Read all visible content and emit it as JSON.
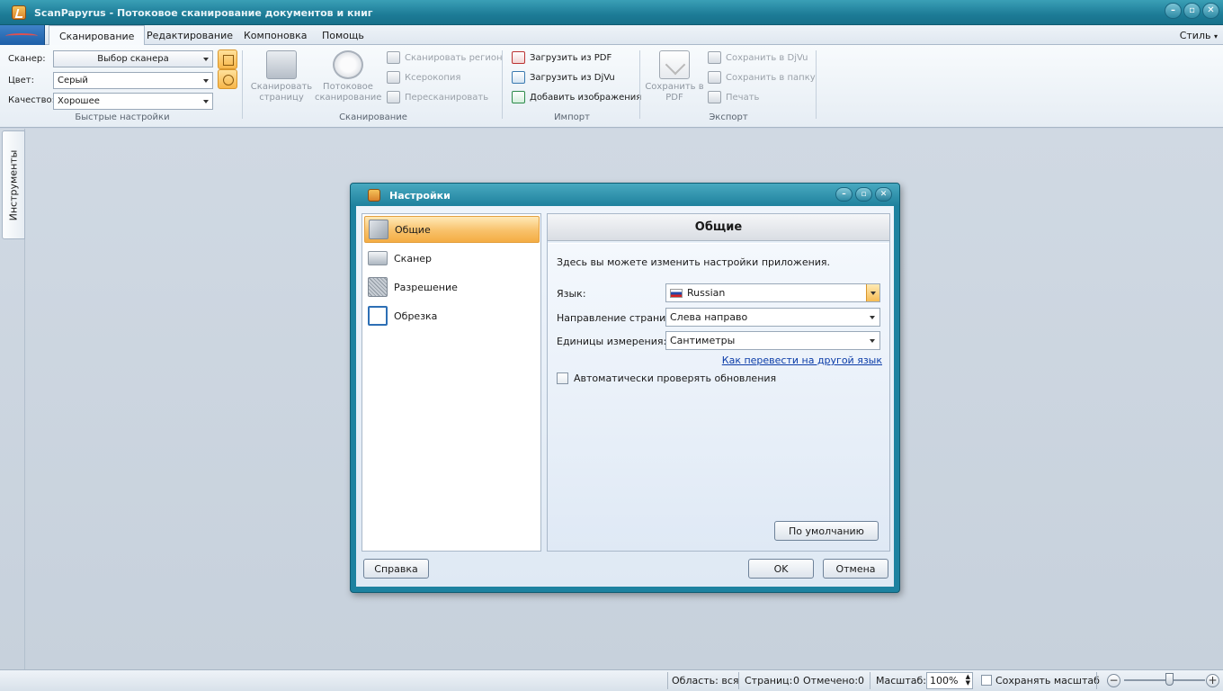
{
  "app": {
    "title": "ScanPapyrus - Потоковое сканирование документов и книг"
  },
  "ribbon": {
    "tabs": [
      "Сканирование",
      "Редактирование",
      "Компоновка",
      "Помощь"
    ],
    "style_menu": "Стиль",
    "quick_settings": {
      "scanner_label": "Сканер:",
      "scanner_value": "Выбор сканера",
      "color_label": "Цвет:",
      "color_value": "Серый",
      "quality_label": "Качество:",
      "quality_value": "Хорошее",
      "group_label": "Быстрые настройки"
    },
    "scanning": {
      "scan_page": "Сканировать страницу",
      "stream_scan": "Потоковое сканирование",
      "scan_region": "Сканировать регион",
      "xerocopy": "Ксерокопия",
      "rescan": "Пересканировать",
      "group_label": "Сканирование"
    },
    "import": {
      "load_pdf": "Загрузить из PDF",
      "load_djvu": "Загрузить из DjVu",
      "add_images": "Добавить изображения",
      "group_label": "Импорт"
    },
    "export": {
      "save_pdf": "Сохранить в PDF",
      "save_djvu": "Сохранить в DjVu",
      "save_folder": "Сохранить в папку",
      "print": "Печать",
      "group_label": "Экспорт"
    }
  },
  "side_panel": {
    "tools_tab": "Инструменты"
  },
  "dialog": {
    "title": "Настройки",
    "nav": [
      "Общие",
      "Сканер",
      "Разрешение",
      "Обрезка"
    ],
    "selected_nav": "Общие",
    "content": {
      "header": "Общие",
      "description": "Здесь вы можете изменить настройки приложения.",
      "language_label": "Язык:",
      "language_value": "Russian",
      "direction_label": "Направление страниц:",
      "direction_value": "Слева направо",
      "units_label": "Единицы измерения:",
      "units_value": "Сантиметры",
      "translate_link": "Как перевести на другой язык",
      "auto_update_label": "Автоматически проверять обновления",
      "auto_update_checked": false,
      "default_button": "По умолчанию"
    },
    "buttons": {
      "help": "Справка",
      "ok": "OK",
      "cancel": "Отмена"
    }
  },
  "statusbar": {
    "area": "Область: вся",
    "pages_label": "Страниц:",
    "pages_value": "0",
    "marked_label": "Отмечено:",
    "marked_value": "0",
    "zoom_label": "Масштаб:",
    "zoom_value": "100%",
    "keep_zoom_label": "Сохранять масштаб",
    "keep_zoom_checked": false,
    "zoom_slider_fraction": 0.55
  }
}
